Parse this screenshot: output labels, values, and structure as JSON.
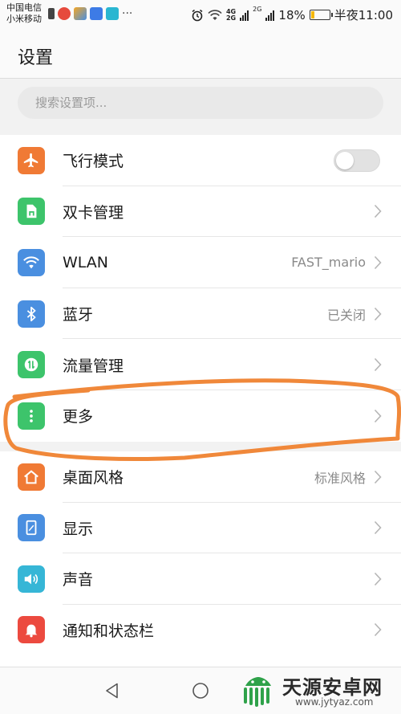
{
  "status_bar": {
    "carrier_1": "中国电信",
    "carrier_2": "小米移动",
    "more_indicator": "···",
    "net_1": "4G",
    "net_2": "2G",
    "battery_percent": "18%",
    "battery_level": 0.18,
    "time": "半夜11:00"
  },
  "header": {
    "title": "设置"
  },
  "search": {
    "placeholder": "搜索设置项..."
  },
  "groups": [
    {
      "items": [
        {
          "label": "飞行模式",
          "value": "",
          "icon": "airplane-icon",
          "icon_color": "#f07a35",
          "control": "toggle",
          "on": false
        },
        {
          "label": "双卡管理",
          "value": "",
          "icon": "sim-card-icon",
          "icon_color": "#3dc46b",
          "control": "chevron"
        },
        {
          "label": "WLAN",
          "value": "FAST_mario",
          "icon": "wifi-icon",
          "icon_color": "#4a8fe0",
          "control": "chevron"
        },
        {
          "label": "蓝牙",
          "value": "已关闭",
          "icon": "bluetooth-icon",
          "icon_color": "#4a8fe0",
          "control": "chevron"
        },
        {
          "label": "流量管理",
          "value": "",
          "icon": "data-usage-icon",
          "icon_color": "#3dc46b",
          "control": "chevron"
        },
        {
          "label": "更多",
          "value": "",
          "icon": "more-dots-icon",
          "icon_color": "#3dc46b",
          "control": "chevron"
        }
      ]
    },
    {
      "items": [
        {
          "label": "桌面风格",
          "value": "标准风格",
          "icon": "home-style-icon",
          "icon_color": "#f07a35",
          "control": "chevron"
        },
        {
          "label": "显示",
          "value": "",
          "icon": "display-icon",
          "icon_color": "#4a8fe0",
          "control": "chevron"
        },
        {
          "label": "声音",
          "value": "",
          "icon": "speaker-icon",
          "icon_color": "#36b6d6",
          "control": "chevron"
        },
        {
          "label": "通知和状态栏",
          "value": "",
          "icon": "bell-icon",
          "icon_color": "#ec4a3f",
          "control": "chevron"
        }
      ]
    }
  ],
  "watermark": {
    "name": "天源安卓网",
    "url": "www.jytyaz.com"
  },
  "annotation_color": "#f0883a"
}
